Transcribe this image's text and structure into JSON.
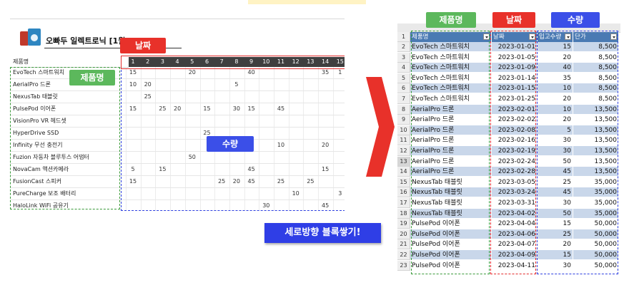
{
  "labels": {
    "product_name": "제품명",
    "date": "날짜",
    "quantity": "수량",
    "banner": "세로방향 블록쌓기!"
  },
  "left_sheet": {
    "title": "오빠두 일렉트로닉 [1월]",
    "name_header": "제품명",
    "days": [
      "1",
      "2",
      "3",
      "4",
      "5",
      "6",
      "7",
      "8",
      "9",
      "10",
      "11",
      "12",
      "13",
      "14",
      "15"
    ],
    "rows": [
      {
        "name": "EvoTech 스마트워치",
        "values": {
          "1": "15",
          "5": "20",
          "9": "40",
          "14": "35",
          "15": "1"
        }
      },
      {
        "name": "AerialPro 드론",
        "values": {
          "1": "10",
          "2": "20",
          "8": "5"
        }
      },
      {
        "name": "NexusTab 태블릿",
        "values": {
          "2": "25"
        }
      },
      {
        "name": "PulsePod 이어폰",
        "values": {
          "1": "15",
          "3": "25",
          "4": "20",
          "6": "15",
          "8": "30",
          "9": "15",
          "11": "45"
        }
      },
      {
        "name": "VisionPro VR 헤드셋",
        "values": {}
      },
      {
        "name": "HyperDrive SSD",
        "values": {
          "6": "25"
        }
      },
      {
        "name": "Infinity 무선 충전기",
        "values": {
          "11": "10",
          "14": "20"
        }
      },
      {
        "name": "Fuzion 자동차 블루투스 어댑터",
        "values": {
          "5": "50"
        }
      },
      {
        "name": "NovaCam 액션카메라",
        "values": {
          "1": "5",
          "3": "15",
          "9": "45",
          "14": "15"
        }
      },
      {
        "name": "FusionCast 스피커",
        "values": {
          "1": "15",
          "7": "25",
          "8": "20",
          "9": "45",
          "11": "25",
          "13": "25"
        }
      },
      {
        "name": "PureCharge 보조 배터리",
        "values": {
          "12": "10",
          "15": "3"
        }
      },
      {
        "name": "HaloLink WiFi 공유기",
        "values": {
          "10": "30",
          "14": "45"
        }
      }
    ]
  },
  "right_sheet": {
    "headers": [
      "제품명",
      "날짜",
      "입고수량",
      "단가"
    ],
    "rows": [
      {
        "num": "2",
        "name": "EvoTech 스마트워치",
        "date": "2023-01-01",
        "qty": "15",
        "price": "8,500"
      },
      {
        "num": "3",
        "name": "EvoTech 스마트워치",
        "date": "2023-01-05",
        "qty": "20",
        "price": "8,500"
      },
      {
        "num": "4",
        "name": "EvoTech 스마트워치",
        "date": "2023-01-09",
        "qty": "40",
        "price": "8,500"
      },
      {
        "num": "5",
        "name": "EvoTech 스마트워치",
        "date": "2023-01-14",
        "qty": "35",
        "price": "8,500"
      },
      {
        "num": "6",
        "name": "EvoTech 스마트워치",
        "date": "2023-01-15",
        "qty": "10",
        "price": "8,500"
      },
      {
        "num": "7",
        "name": "EvoTech 스마트워치",
        "date": "2023-01-25",
        "qty": "20",
        "price": "8,500"
      },
      {
        "num": "8",
        "name": "AerialPro 드론",
        "date": "2023-02-01",
        "qty": "10",
        "price": "13,500"
      },
      {
        "num": "9",
        "name": "AerialPro 드론",
        "date": "2023-02-02",
        "qty": "20",
        "price": "13,500"
      },
      {
        "num": "10",
        "name": "AerialPro 드론",
        "date": "2023-02-08",
        "qty": "5",
        "price": "13,500"
      },
      {
        "num": "11",
        "name": "AerialPro 드론",
        "date": "2023-02-16",
        "qty": "30",
        "price": "13,500"
      },
      {
        "num": "12",
        "name": "AerialPro 드론",
        "date": "2023-02-19",
        "qty": "30",
        "price": "13,500"
      },
      {
        "num": "13",
        "name": "AerialPro 드론",
        "date": "2023-02-24",
        "qty": "50",
        "price": "13,500"
      },
      {
        "num": "14",
        "name": "AerialPro 드론",
        "date": "2023-02-28",
        "qty": "45",
        "price": "13,500"
      },
      {
        "num": "15",
        "name": "NexusTab 태블릿",
        "date": "2023-03-05",
        "qty": "25",
        "price": "35,000"
      },
      {
        "num": "16",
        "name": "NexusTab 태블릿",
        "date": "2023-03-24",
        "qty": "45",
        "price": "35,000"
      },
      {
        "num": "17",
        "name": "NexusTab 태블릿",
        "date": "2023-03-31",
        "qty": "30",
        "price": "35,000"
      },
      {
        "num": "18",
        "name": "NexusTab 태블릿",
        "date": "2023-04-02",
        "qty": "50",
        "price": "35,000"
      },
      {
        "num": "19",
        "name": "PulsePod 이어폰",
        "date": "2023-04-04",
        "qty": "15",
        "price": "50,000"
      },
      {
        "num": "20",
        "name": "PulsePod 이어폰",
        "date": "2023-04-06",
        "qty": "25",
        "price": "50,000"
      },
      {
        "num": "21",
        "name": "PulsePod 이어폰",
        "date": "2023-04-07",
        "qty": "20",
        "price": "50,000"
      },
      {
        "num": "22",
        "name": "PulsePod 이어폰",
        "date": "2023-04-09",
        "qty": "15",
        "price": "50,000"
      },
      {
        "num": "23",
        "name": "PulsePod 이어폰",
        "date": "2023-04-11",
        "qty": "30",
        "price": "50,000"
      }
    ]
  },
  "colors": {
    "green": "#5cb85c",
    "red": "#e8312a",
    "blue": "#3b4fe8",
    "header_blue": "#4a7ab3",
    "row_band": "#c9d7ea"
  },
  "icons": {
    "arrow": "right-arrow-icon",
    "logo": "product-logo-icon",
    "filter": "filter-dropdown-icon"
  }
}
